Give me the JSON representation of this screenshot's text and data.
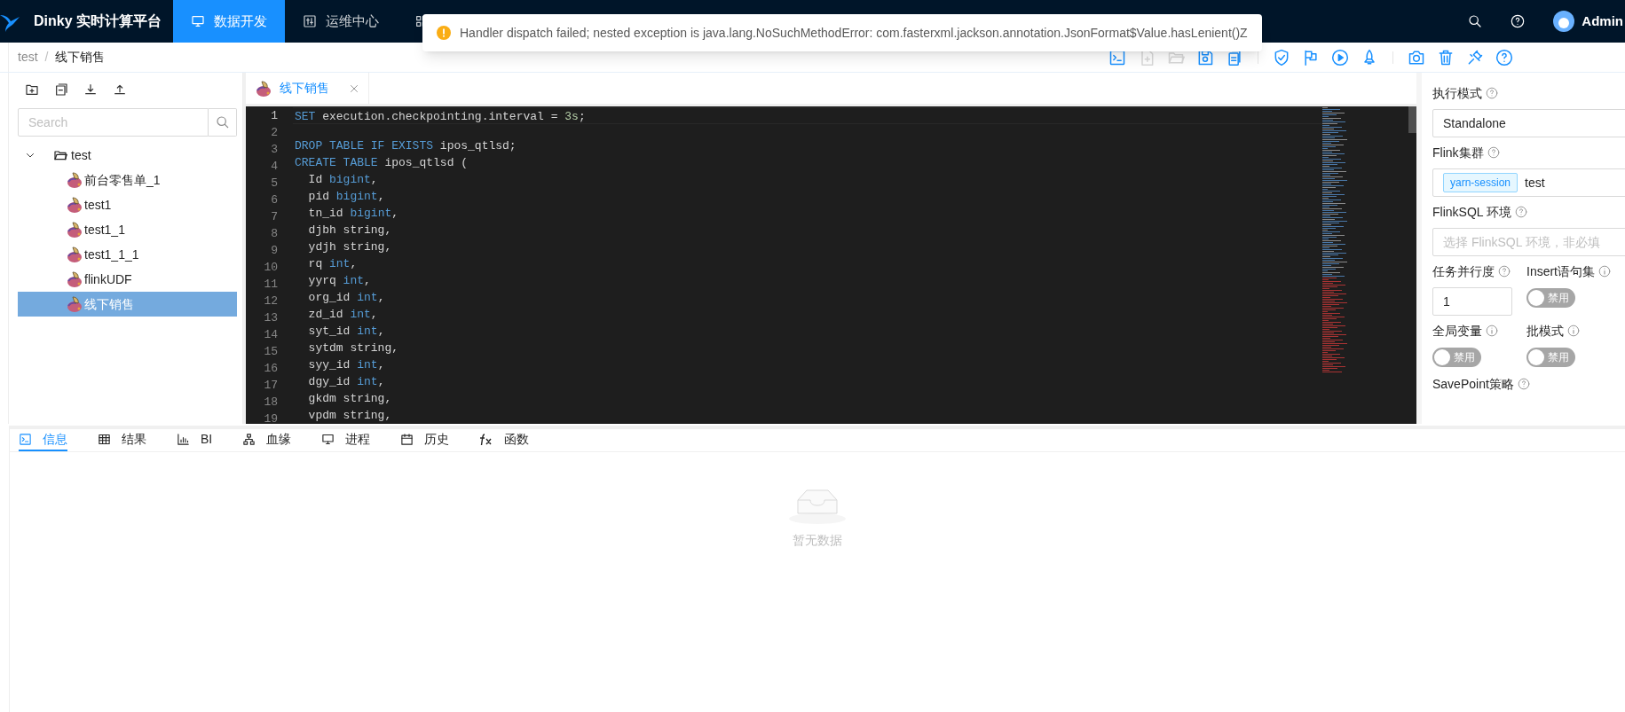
{
  "header": {
    "title": "Dinky 实时计算平台",
    "nav": [
      {
        "label": "数据开发",
        "kind": "sql",
        "selected": true
      },
      {
        "label": "运维中心",
        "kind": "sliders",
        "selected": false
      },
      {
        "kind": "grid",
        "selected": false
      }
    ],
    "user": "Admin"
  },
  "toast": {
    "message": "Handler dispatch failed; nested exception is java.lang.NoSuchMethodError: com.fasterxml.jackson.annotation.JsonFormat$Value.hasLenient()Z"
  },
  "breadcrumb": {
    "separator": "/",
    "items": [
      "test",
      "线下销售"
    ]
  },
  "toolbar": [
    {
      "kind": "console",
      "disabled": false
    },
    {
      "kind": "new-file",
      "disabled": true
    },
    {
      "kind": "folder",
      "disabled": true
    },
    {
      "kind": "save",
      "disabled": false
    },
    {
      "kind": "copy",
      "disabled": false
    },
    {
      "kind": "divider"
    },
    {
      "kind": "shield",
      "disabled": false
    },
    {
      "kind": "flag",
      "disabled": false
    },
    {
      "kind": "play",
      "disabled": false
    },
    {
      "kind": "rocket",
      "disabled": false
    },
    {
      "kind": "divider"
    },
    {
      "kind": "camera",
      "disabled": false
    },
    {
      "kind": "trash",
      "disabled": false
    },
    {
      "kind": "plug",
      "disabled": false
    },
    {
      "kind": "help",
      "disabled": false
    }
  ],
  "tree": {
    "search": {
      "placeholder": "Search"
    },
    "root": {
      "label": "test",
      "expanded": true,
      "children": [
        {
          "label": "前台零售单_1",
          "selected": false
        },
        {
          "label": "test1",
          "selected": false
        },
        {
          "label": "test1_1",
          "selected": false
        },
        {
          "label": "test1_1_1",
          "selected": false
        },
        {
          "label": "flinkUDF",
          "selected": false
        },
        {
          "label": "线下销售",
          "selected": true
        }
      ]
    }
  },
  "editor": {
    "tabs": [
      {
        "label": "线下销售",
        "selected": true
      }
    ],
    "lines": [
      {
        "number": "1",
        "tokens": [
          {
            "kind": "keyword",
            "text": "SET"
          },
          {
            "kind": "plain",
            "text": " execution.checkpointing.interval"
          },
          {
            "kind": "operator",
            "text": " = "
          },
          {
            "kind": "number",
            "text": "3s"
          },
          {
            "kind": "plain",
            "text": ";"
          }
        ]
      },
      {
        "number": "2"
      },
      {
        "number": "3",
        "tokens": [
          {
            "kind": "keyword",
            "text": "DROP TABLE IF EXISTS"
          },
          {
            "kind": "plain",
            "text": " ipos_qtlsd;"
          }
        ]
      },
      {
        "number": "4",
        "tokens": [
          {
            "kind": "keyword",
            "text": "CREATE TABLE"
          },
          {
            "kind": "plain",
            "text": " ipos_qtlsd ("
          }
        ]
      },
      {
        "number": "5",
        "tokens": [
          {
            "kind": "plain",
            "text": "  Id "
          },
          {
            "kind": "type",
            "text": "bigint"
          },
          {
            "kind": "plain",
            "text": ","
          }
        ]
      },
      {
        "number": "6",
        "tokens": [
          {
            "kind": "plain",
            "text": "  pid "
          },
          {
            "kind": "type",
            "text": "bigint"
          },
          {
            "kind": "plain",
            "text": ","
          }
        ]
      },
      {
        "number": "7",
        "tokens": [
          {
            "kind": "plain",
            "text": "  tn_id "
          },
          {
            "kind": "type",
            "text": "bigint"
          },
          {
            "kind": "plain",
            "text": ","
          }
        ]
      },
      {
        "number": "8",
        "tokens": [
          {
            "kind": "plain",
            "text": "  djbh string,"
          }
        ]
      },
      {
        "number": "9",
        "tokens": [
          {
            "kind": "plain",
            "text": "  ydjh string,"
          }
        ]
      },
      {
        "number": "10",
        "tokens": [
          {
            "kind": "plain",
            "text": "  rq "
          },
          {
            "kind": "type",
            "text": "int"
          },
          {
            "kind": "plain",
            "text": ","
          }
        ]
      },
      {
        "number": "11",
        "tokens": [
          {
            "kind": "plain",
            "text": "  yyrq "
          },
          {
            "kind": "type",
            "text": "int"
          },
          {
            "kind": "plain",
            "text": ","
          }
        ]
      },
      {
        "number": "12",
        "tokens": [
          {
            "kind": "plain",
            "text": "  org_id "
          },
          {
            "kind": "type",
            "text": "int"
          },
          {
            "kind": "plain",
            "text": ","
          }
        ]
      },
      {
        "number": "13",
        "tokens": [
          {
            "kind": "plain",
            "text": "  zd_id "
          },
          {
            "kind": "type",
            "text": "int"
          },
          {
            "kind": "plain",
            "text": ","
          }
        ]
      },
      {
        "number": "14",
        "tokens": [
          {
            "kind": "plain",
            "text": "  syt_id "
          },
          {
            "kind": "type",
            "text": "int"
          },
          {
            "kind": "plain",
            "text": ","
          }
        ]
      },
      {
        "number": "15",
        "tokens": [
          {
            "kind": "plain",
            "text": "  sytdm string,"
          }
        ]
      },
      {
        "number": "16",
        "tokens": [
          {
            "kind": "plain",
            "text": "  syy_id "
          },
          {
            "kind": "type",
            "text": "int"
          },
          {
            "kind": "plain",
            "text": ","
          }
        ]
      },
      {
        "number": "17",
        "tokens": [
          {
            "kind": "plain",
            "text": "  dgy_id "
          },
          {
            "kind": "type",
            "text": "int"
          },
          {
            "kind": "plain",
            "text": ","
          }
        ]
      },
      {
        "number": "18",
        "tokens": [
          {
            "kind": "plain",
            "text": "  gkdm string,"
          }
        ]
      },
      {
        "number": "19",
        "tokens": [
          {
            "kind": "plain",
            "text": "  vpdm string,"
          }
        ]
      }
    ]
  },
  "settings": {
    "exec_mode": {
      "label": "执行模式",
      "value": "Standalone"
    },
    "cluster": {
      "label": "Flink集群",
      "tag": "yarn-session",
      "value": "test"
    },
    "sql_env": {
      "label": "FlinkSQL 环境",
      "placeholder": "选择 FlinkSQL 环境，非必填"
    },
    "parallelism": {
      "label": "任务并行度",
      "value": "1"
    },
    "insert_set": {
      "label": "Insert语句集",
      "on": false,
      "text": "禁用"
    },
    "global_vars": {
      "label": "全局变量",
      "on": false,
      "text": "禁用"
    },
    "batch_mode": {
      "label": "批模式",
      "on": false,
      "text": "禁用"
    },
    "savepoint": {
      "label": "SavePoint策略"
    }
  },
  "bottom_tabs": [
    {
      "label": "信息",
      "kind": "console",
      "selected": true
    },
    {
      "label": "结果",
      "kind": "table",
      "selected": false
    },
    {
      "label": "BI",
      "kind": "bars",
      "selected": false
    },
    {
      "label": "血缘",
      "kind": "tree",
      "selected": false
    },
    {
      "label": "进程",
      "kind": "monitor",
      "selected": false
    },
    {
      "label": "历史",
      "kind": "calendar",
      "selected": false
    },
    {
      "label": "函数",
      "kind": "fx",
      "selected": false
    }
  ],
  "empty": {
    "text": "暂无数据"
  }
}
